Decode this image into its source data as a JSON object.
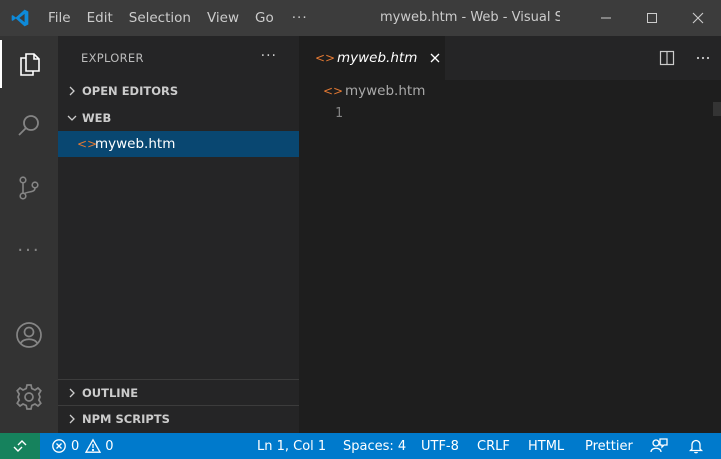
{
  "titlebar": {
    "menu": [
      "File",
      "Edit",
      "Selection",
      "View",
      "Go"
    ],
    "more": "···",
    "title": "myweb.htm - Web - Visual Studio Code",
    "logo_icon": "vscode-logo-icon",
    "colors": {
      "background": "#3c3c3c",
      "logo": "#0e8ad9"
    }
  },
  "activity_bar": {
    "items": [
      {
        "icon": "files-icon",
        "active": true
      },
      {
        "icon": "search-icon"
      },
      {
        "icon": "source-control-icon"
      },
      {
        "icon": "more-icon",
        "label": "···"
      },
      {
        "icon": "account-icon"
      },
      {
        "icon": "gear-icon"
      }
    ]
  },
  "sidebar": {
    "title": "EXPLORER",
    "more": "···",
    "sections": {
      "open_editors": "OPEN EDITORS",
      "web": "WEB",
      "outline": "OUTLINE",
      "npm_scripts": "NPM SCRIPTS"
    },
    "files": [
      {
        "name": "myweb.htm",
        "icon": "html-file-icon",
        "selected": true
      }
    ],
    "colors": {
      "selection": "#094771",
      "file_icon": "#e37933"
    }
  },
  "editor": {
    "tab": {
      "label": "myweb.htm",
      "icon": "html-file-icon"
    },
    "breadcrumb": "myweb.htm",
    "line_numbers": [
      "1"
    ],
    "actions": [
      "split-editor-icon",
      "more-actions-icon"
    ]
  },
  "statusbar": {
    "errors": "0",
    "warnings": "0",
    "cursor": "Ln 1, Col 1",
    "spaces": "Spaces: 4",
    "encoding": "UTF-8",
    "eol": "CRLF",
    "language": "HTML",
    "formatter": "Prettier",
    "colors": {
      "background": "#007acc",
      "remote": "#16825d"
    }
  }
}
